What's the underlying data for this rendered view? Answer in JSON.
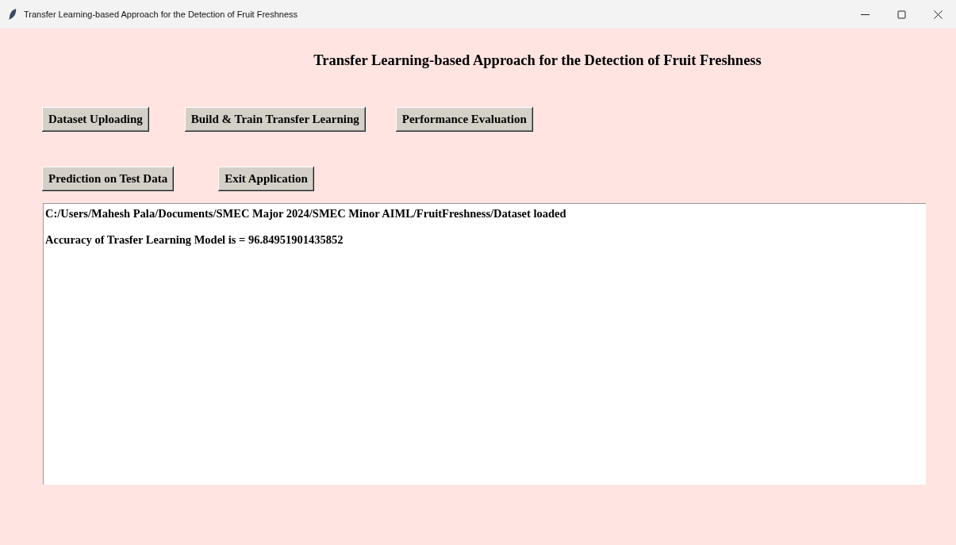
{
  "window": {
    "title": "Transfer Learning-based Approach for the Detection of Fruit Freshness"
  },
  "heading": "Transfer Learning-based Approach for the Detection of Fruit Freshness",
  "button_rows": [
    [
      "Dataset Uploading",
      "Build & Train Transfer Learning",
      "Performance Evaluation"
    ],
    [
      "Prediction on Test Data",
      "Exit Application"
    ]
  ],
  "output_lines": [
    "C:/Users/Mahesh Pala/Documents/SMEC Major 2024/SMEC Minor AIML/FruitFreshness/Dataset loaded",
    "Accuracy of Trasfer Learning Model is = 96.84951901435852"
  ]
}
